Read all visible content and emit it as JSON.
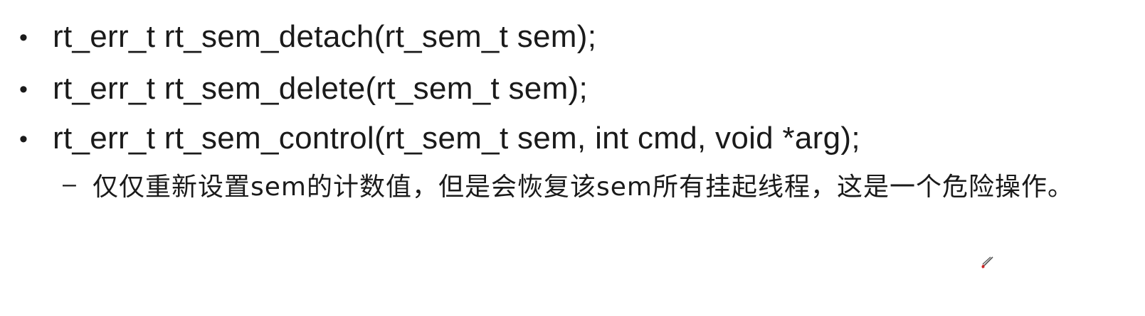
{
  "slide": {
    "bullets": [
      {
        "marker": "•",
        "text": "rt_err_t rt_sem_detach(rt_sem_t sem);"
      },
      {
        "marker": "•",
        "text": "rt_err_t rt_sem_delete(rt_sem_t sem);"
      },
      {
        "marker": "•",
        "text": "rt_err_t rt_sem_control(rt_sem_t sem, int cmd, void *arg);"
      }
    ],
    "sub_bullet": {
      "marker": "–",
      "text": "仅仅重新设置sem的计数值，但是会恢复该sem所有挂起线程，这是一个危险操作。"
    },
    "pointer_icon": "pen-pointer-icon"
  }
}
